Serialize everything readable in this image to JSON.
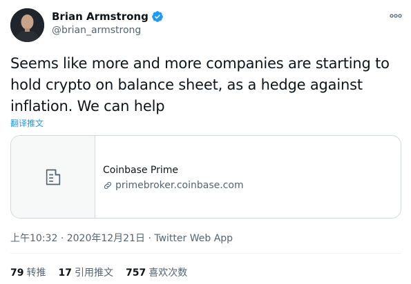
{
  "author": {
    "name": "Brian Armstrong",
    "handle": "@brian_armstrong"
  },
  "tweet": {
    "text": "Seems like more and more companies are starting to hold crypto on balance sheet, as a hedge against inflation. We can help",
    "translate_label": "翻译推文"
  },
  "card": {
    "title": "Coinbase Prime",
    "url": "primebroker.coinbase.com"
  },
  "meta": {
    "time": "上午10:32",
    "date": "2020年12月21日",
    "source": "Twitter Web App"
  },
  "stats": [
    {
      "count": "79",
      "label": "转推"
    },
    {
      "count": "17",
      "label": "引用推文"
    },
    {
      "count": "757",
      "label": "喜欢次数"
    }
  ],
  "colors": {
    "link": "#1d9bf0",
    "verified": "#1d9bf0",
    "secondary_text": "#536471"
  }
}
